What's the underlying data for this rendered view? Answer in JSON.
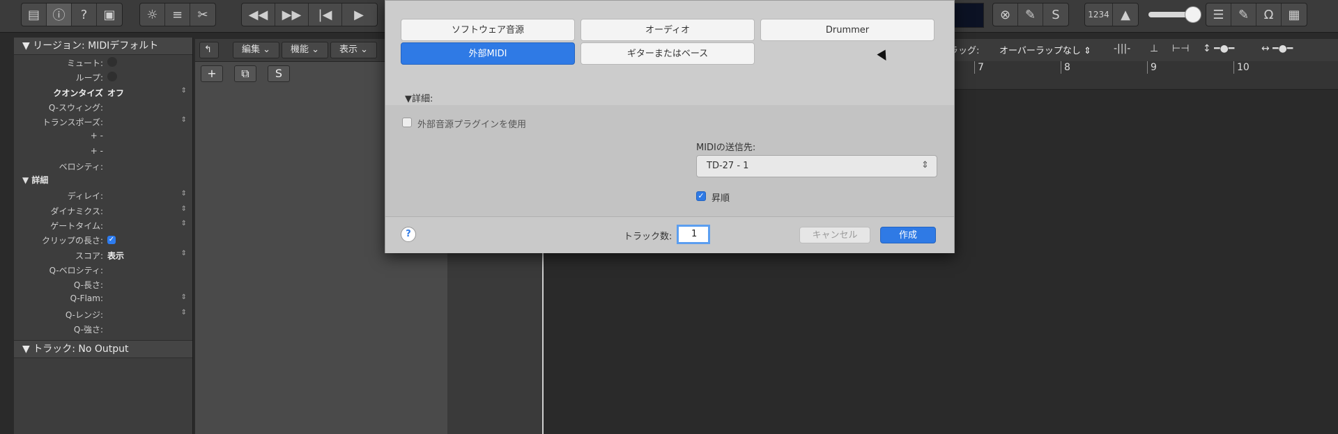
{
  "toolbar": {
    "left_icons": [
      "library-icon",
      "info-icon",
      "help-icon",
      "toolbar-icon",
      "smart-controls-icon",
      "mixer-icon",
      "scissors-icon"
    ],
    "transport_icons": [
      "rewind-icon",
      "fast-forward-icon",
      "to-start-icon",
      "play-icon"
    ],
    "right_icons": [
      "close-circle-icon",
      "pencil-icon",
      "solo-icon"
    ],
    "count_in": "1234",
    "far_right_icons": [
      "list-icon",
      "note-pad-icon",
      "loops-icon",
      "browser-icon"
    ]
  },
  "inspector": {
    "region_label": "リージョン:",
    "region_name": "MIDIデフォルト",
    "rows": [
      {
        "label": "ミュート:",
        "value": ""
      },
      {
        "label": "ループ:",
        "value": ""
      },
      {
        "label": "クオンタイズ",
        "value": "オフ"
      },
      {
        "label": "Q-スウィング:",
        "value": ""
      },
      {
        "label": "トランスポーズ:",
        "value": ""
      },
      {
        "label": "+ -",
        "value": ""
      },
      {
        "label": "+ -",
        "value": ""
      },
      {
        "label": "ベロシティ:",
        "value": ""
      }
    ],
    "detail_label": "詳細",
    "detail_rows": [
      {
        "label": "ディレイ:",
        "value": ""
      },
      {
        "label": "ダイナミクス:",
        "value": ""
      },
      {
        "label": "ゲートタイム:",
        "value": ""
      },
      {
        "label": "クリップの長さ:",
        "value": "✓"
      },
      {
        "label": "スコア:",
        "value": "表示"
      },
      {
        "label": "Q-ベロシティ:",
        "value": ""
      },
      {
        "label": "Q-長さ:",
        "value": ""
      },
      {
        "label": "Q-Flam:",
        "value": ""
      },
      {
        "label": "Q-レンジ:",
        "value": ""
      },
      {
        "label": "Q-強さ:",
        "value": ""
      }
    ],
    "track_label": "トラック:",
    "track_value": "No Output"
  },
  "local_menu": {
    "edit": "編集",
    "functions": "機能",
    "view": "表示",
    "drag_label": "ラッグ:",
    "drag_value": "オーバーラップなし"
  },
  "track_buttons": {
    "add": "+",
    "duplicate": "⧉",
    "solo": "S"
  },
  "ruler": [
    "7",
    "8",
    "9",
    "10"
  ],
  "dialog": {
    "types": {
      "software": "ソフトウェア音源",
      "audio": "オーディオ",
      "drummer": "Drummer",
      "external_midi": "外部MIDI",
      "guitar_bass": "ギターまたはベース"
    },
    "details": "▼詳細:",
    "use_plugin": "外部音源プラグインを使用",
    "midi_dest_label": "MIDIの送信先:",
    "midi_dest_value": "TD-27 - 1",
    "ascending": "昇順",
    "help": "?",
    "track_count_label": "トラック数:",
    "track_count_value": "1",
    "cancel": "キャンセル",
    "create": "作成"
  }
}
